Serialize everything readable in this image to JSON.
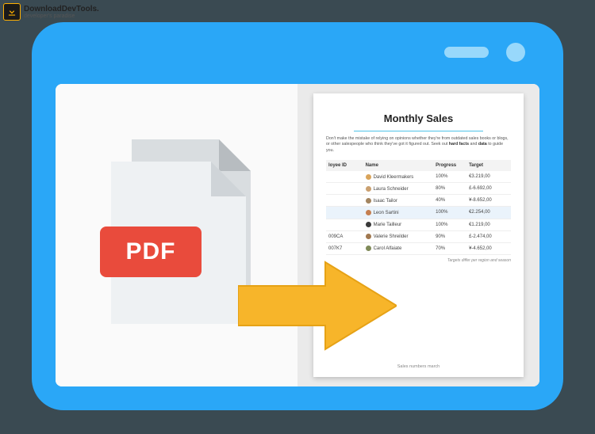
{
  "watermark": {
    "title": "DownloadDevTools.",
    "subtitle": "developer's paradise"
  },
  "pdf_label": "PDF",
  "doc": {
    "title": "Monthly Sales",
    "paragraph_prefix": "Don't make the mistake of relying on opinions whether they're from outdated sales books or blogs, or other salespeople who think they've got it figured out. Seek out ",
    "paragraph_b1": "hard facts",
    "paragraph_mid": " and ",
    "paragraph_b2": "data",
    "paragraph_suffix": " to guide you.",
    "columns": {
      "c1": "loyee ID",
      "c2": "Name",
      "c3": "Progress",
      "c4": "Target"
    },
    "rows": [
      {
        "id": "",
        "name": "David Kleermakers",
        "progress": "100%",
        "target": "€3.219,00",
        "color": "#d9a45b"
      },
      {
        "id": "",
        "name": "Laura Schneider",
        "progress": "80%",
        "target": "£-6.692,00",
        "color": "#caa070"
      },
      {
        "id": "",
        "name": "Isaac Tailor",
        "progress": "40%",
        "target": "¥-8.652,00",
        "color": "#a38560"
      },
      {
        "id": "",
        "name": "Leon Sartini",
        "progress": "100%",
        "target": "€2.254,00",
        "color": "#c57f50",
        "hl": true
      },
      {
        "id": "",
        "name": "Marie Tailleur",
        "progress": "100%",
        "target": "€1.219,00",
        "color": "#3a3a3a"
      },
      {
        "id": "009CA",
        "name": "Valerie Shreilder",
        "progress": "90%",
        "target": "£-2.474,00",
        "color": "#a07850"
      },
      {
        "id": "007K7",
        "name": "Carol Alfaiate",
        "progress": "70%",
        "target": "¥-4.652,00",
        "color": "#7f8a58"
      }
    ],
    "footnote": "Targets differ per region and season",
    "caption": "Sales numbers march"
  }
}
